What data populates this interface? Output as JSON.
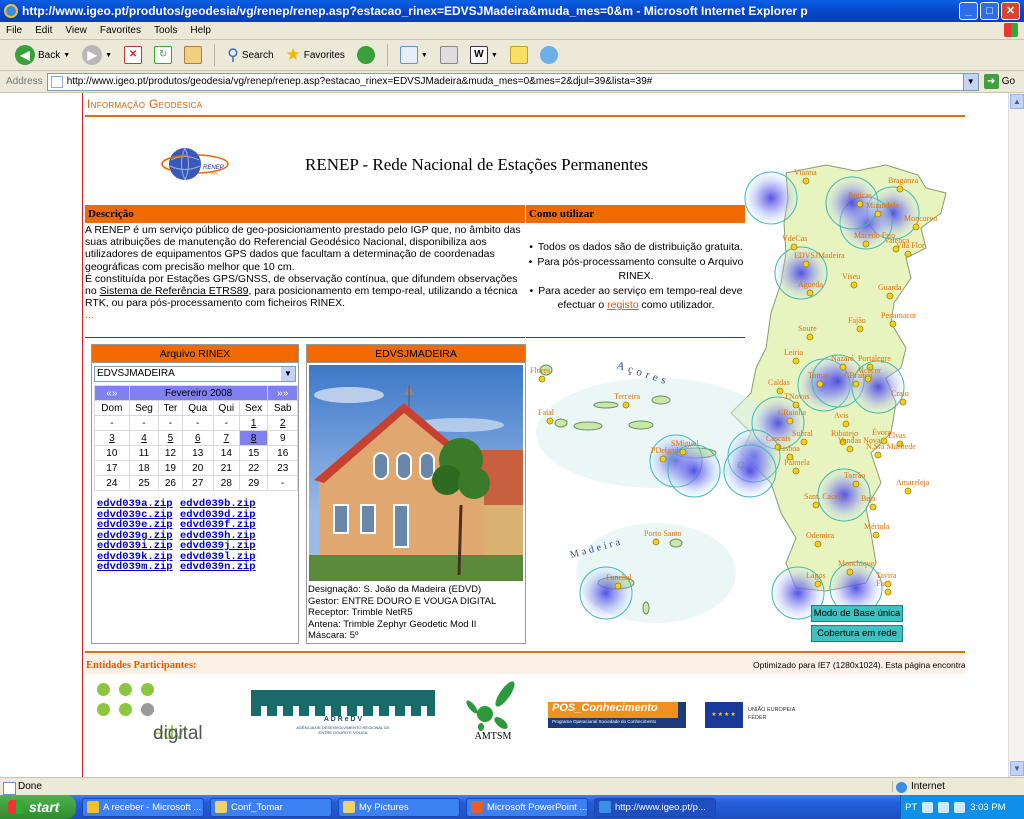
{
  "window": {
    "title": "http://www.igeo.pt/produtos/geodesia/vg/renep/renep.asp?estacao_rinex=EDVSJMadeira&muda_mes=0&m - Microsoft Internet Explorer p"
  },
  "menu": [
    "File",
    "Edit",
    "View",
    "Favorites",
    "Tools",
    "Help"
  ],
  "toolbar": {
    "back": "Back",
    "search": "Search",
    "favorites": "Favorites"
  },
  "address": {
    "label": "Address",
    "url": "http://www.igeo.pt/produtos/geodesia/vg/renep/renep.asp?estacao_rinex=EDVSJMadeira&muda_mes=0&mes=2&djul=39&lista=39#",
    "go": "Go"
  },
  "site": {
    "header": "Informação Geodésica",
    "logo_text": "RENEP",
    "logo_sub": "GPS",
    "title": "RENEP - Rede Nacional de Estações Permanentes"
  },
  "descricao": {
    "title": "Descrição",
    "p1": "A RENEP é um serviço público de geo-posicionamento prestado pelo IGP que, no âmbito das suas atribuições de manutenção do Referencial Geodésico Nacional, disponibiliza aos utilizadores de equipamentos GPS dados que facultam a determinação de coordenadas geográficas com precisão melhor que 10 cm.",
    "p2a": "É constituída por Estações GPS/GNSS, de observação contínua, que difundem observações no ",
    "p2link": "Sistema de Referência ETRS89",
    "p2b": ", para posicionamento em tempo-real, utilizando a técnica RTK, ou para pós-processamento com ficheiros RINEX.",
    "more": "..."
  },
  "como": {
    "title": "Como utilizar",
    "b1": "Todos os dados são de distribuição gratuita.",
    "b2": "Para pós-processamento consulte o Arquivo RINEX.",
    "b3a": "Para aceder ao serviço em tempo-real deve efectuar o ",
    "b3link": "registo",
    "b3b": " como utilizador."
  },
  "arquivo": {
    "title": "Arquivo RINEX",
    "select_value": "EDVSJMADEIRA",
    "prev": "«»",
    "next": "»»",
    "month": "Fevereiro 2008",
    "days_header": [
      "Dom",
      "Seg",
      "Ter",
      "Qua",
      "Qui",
      "Sex",
      "Sab"
    ],
    "weeks": [
      [
        "-",
        "-",
        "-",
        "-",
        "-",
        "1",
        "2"
      ],
      [
        "3",
        "4",
        "5",
        "6",
        "7",
        "8",
        "9"
      ],
      [
        "10",
        "11",
        "12",
        "13",
        "14",
        "15",
        "16"
      ],
      [
        "17",
        "18",
        "19",
        "20",
        "21",
        "22",
        "23"
      ],
      [
        "24",
        "25",
        "26",
        "27",
        "28",
        "29",
        "-"
      ]
    ],
    "linked_days": [
      "1",
      "2",
      "3",
      "4",
      "5",
      "6",
      "7",
      "8"
    ],
    "selected_day": "8",
    "files": [
      "edvd039a.zip",
      "edvd039b.zip",
      "edvd039c.zip",
      "edvd039d.zip",
      "edvd039e.zip",
      "edvd039f.zip",
      "edvd039g.zip",
      "edvd039h.zip",
      "edvd039i.zip",
      "edvd039j.zip",
      "edvd039k.zip",
      "edvd039l.zip",
      "edvd039m.zip",
      "edvd039n.zip"
    ]
  },
  "station": {
    "title": "EDVSJMADEIRA",
    "designacao": "Designação: S. João da Madeira (EDVD)",
    "gestor": "Gestor: ENTRE DOURO E VOUGA DIGITAL",
    "receptor": "Receptor: Trimble NetR5",
    "antena": "Antena: Trimble Zephyr Geodetic Mod II",
    "mascara": "Máscara: 5º"
  },
  "map": {
    "labels": [
      "Açores",
      "Madeira",
      "Flores",
      "Faial",
      "Terceira",
      "PDelgada",
      "SMiguel",
      "Funchal",
      "Porto Santo",
      "Vianna",
      "Braganza",
      "Boticas",
      "Mirandela",
      "Moncorvo",
      "Valença",
      "VdeCas",
      "Macedo Frio",
      "Vila Flor",
      "EDVSJMadeira",
      "Agueda",
      "Viseu",
      "Guarda",
      "Fajão",
      "Penamacor",
      "Soure",
      "Leiria",
      "Nazaré",
      "Tomar",
      "CBranco",
      "Caldas",
      "TNovas",
      "Portalegre",
      "Alcácer",
      "CRainha",
      "Sobral",
      "Ribatejo",
      "Avis",
      "Crato",
      "Elvas",
      "Cascais",
      "Lisboa",
      "Palmela",
      "Vendas Novas",
      "Évora",
      "N.Sra Machede",
      "Torrão",
      "Amareleja",
      "Sant. Cacém",
      "Beja",
      "Mértola",
      "Odemira",
      "Monchique",
      "Lagos",
      "Faro",
      "Tavira"
    ],
    "btn_base": "Modo de Base única",
    "btn_rede": "Cobertura em rede"
  },
  "footer": {
    "entidades": "Entidades Participantes:",
    "optim": "Optimizado para IE7 (1280x1024). Esta página encontra",
    "edv1": "edv",
    "edv2": "digital",
    "adrediv": "A D R e D V",
    "adrediv_sub": "AGÊNCIA DE DESENVOLVIMENTO REGIONAL DE ENTRE DOURO E VOUGA",
    "amtsm": "AMTSM",
    "pos": "POS_Conhecimento",
    "pos_sub": "Programa Operacional Sociedade do Conhecimento",
    "ue1": "UNIÃO EUROPEIA",
    "ue2": "FEDER"
  },
  "status": {
    "left": "Done",
    "zone": "Internet"
  },
  "taskbar": {
    "start": "start",
    "tasks": [
      "A receber - Microsoft ...",
      "Conf_Tomar",
      "My Pictures",
      "Microsoft PowerPoint ...",
      "http://www.igeo.pt/p..."
    ],
    "lang": "PT",
    "clock": "3:03 PM"
  },
  "colors": {
    "accent": "#f06a00",
    "calendar": "#8080f0",
    "xp_blue": "#245edb"
  }
}
